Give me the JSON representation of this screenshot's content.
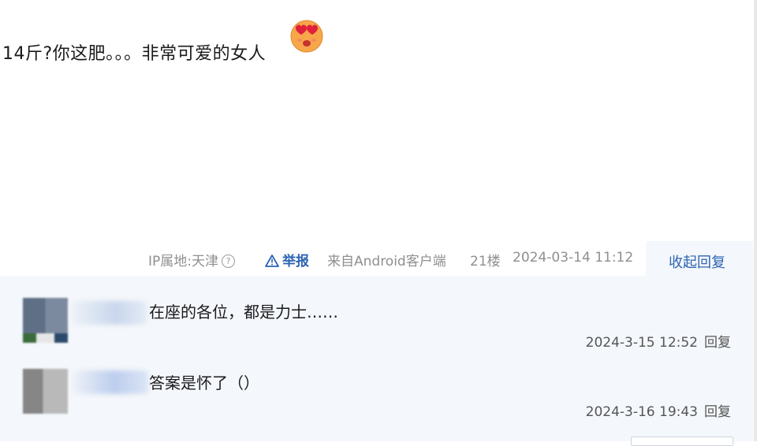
{
  "post": {
    "text": "14斤?你这肥。。。非常可爱的女人",
    "emoji": "heart-eyes-kiss-emoji"
  },
  "meta": {
    "ip_label": "IP属地:天津",
    "report_label": "举报",
    "client_label": "来自Android客户端",
    "floor": "21楼",
    "time": "2024-03-14 11:12",
    "collapse_label": "收起回复"
  },
  "replies": [
    {
      "text": "在座的各位，都是力士……",
      "time": "2024-3-15 12:52",
      "reply_label": "回复"
    },
    {
      "text": "答案是怀了（）",
      "time": "2024-3-16 19:43",
      "reply_label": "回复"
    }
  ],
  "colors": {
    "link": "#2d64b3",
    "meta": "#8f8f8f",
    "reply_bg": "#f4f7fb"
  }
}
